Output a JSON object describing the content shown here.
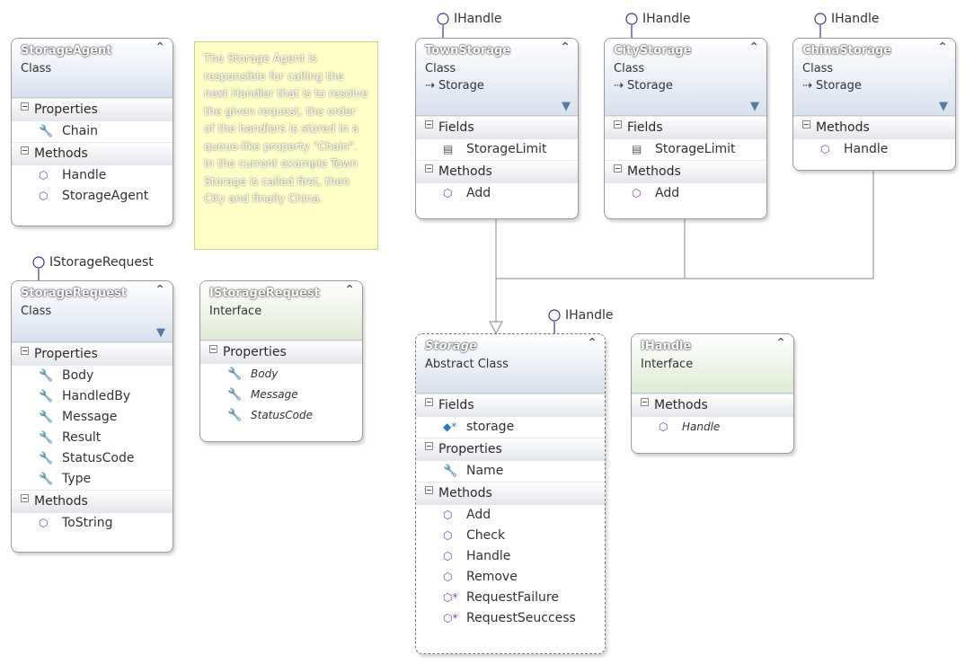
{
  "note": {
    "text": "The Storage Agent is responsible for calling the next Handler that is to resolve the given request, the order of the handlers is stored in a queue-like property \"Chain\". In the current example Town Storage is called first, then City and finally China."
  },
  "lollipops": {
    "town": "IHandle",
    "city": "IHandle",
    "china": "IHandle",
    "storage_request": "IStorageRequest",
    "storage": "IHandle"
  },
  "boxes": {
    "storage_agent": {
      "title": "StorageAgent",
      "stereotype": "Class",
      "sections": [
        {
          "label": "Properties",
          "items": [
            {
              "icon": "wrench-property-icon",
              "name": "Chain"
            }
          ]
        },
        {
          "label": "Methods",
          "items": [
            {
              "icon": "method-cube-icon",
              "name": "Handle"
            },
            {
              "icon": "method-cube-icon",
              "name": "StorageAgent"
            }
          ]
        }
      ]
    },
    "town_storage": {
      "title": "TownStorage",
      "stereotype": "Class",
      "base": "Storage",
      "sections": [
        {
          "label": "Fields",
          "items": [
            {
              "icon": "field-icon",
              "name": "StorageLimit"
            }
          ]
        },
        {
          "label": "Methods",
          "items": [
            {
              "icon": "method-cube-icon",
              "name": "Add"
            }
          ]
        }
      ]
    },
    "city_storage": {
      "title": "CityStorage",
      "stereotype": "Class",
      "base": "Storage",
      "sections": [
        {
          "label": "Fields",
          "items": [
            {
              "icon": "field-icon",
              "name": "StorageLimit"
            }
          ]
        },
        {
          "label": "Methods",
          "items": [
            {
              "icon": "method-cube-icon",
              "name": "Add"
            }
          ]
        }
      ]
    },
    "china_storage": {
      "title": "ChinaStorage",
      "stereotype": "Class",
      "base": "Storage",
      "sections": [
        {
          "label": "Methods",
          "items": [
            {
              "icon": "method-cube-icon",
              "name": "Handle"
            }
          ]
        }
      ]
    },
    "storage_request": {
      "title": "StorageRequest",
      "stereotype": "Class",
      "sections": [
        {
          "label": "Properties",
          "items": [
            {
              "icon": "wrench-property-icon",
              "name": "Body"
            },
            {
              "icon": "wrench-property-icon",
              "name": "HandledBy"
            },
            {
              "icon": "wrench-property-icon",
              "name": "Message"
            },
            {
              "icon": "wrench-property-icon",
              "name": "Result"
            },
            {
              "icon": "wrench-property-icon",
              "name": "StatusCode"
            },
            {
              "icon": "wrench-property-icon",
              "name": "Type"
            }
          ]
        },
        {
          "label": "Methods",
          "items": [
            {
              "icon": "method-cube-icon",
              "name": "ToString"
            }
          ]
        }
      ]
    },
    "istorage_request": {
      "title": "IStorageRequest",
      "stereotype": "Interface",
      "sections": [
        {
          "label": "Properties",
          "items": [
            {
              "icon": "wrench-property-icon",
              "name": "Body"
            },
            {
              "icon": "wrench-property-icon",
              "name": "Message"
            },
            {
              "icon": "wrench-property-icon",
              "name": "StatusCode"
            }
          ]
        }
      ]
    },
    "storage": {
      "title": "Storage",
      "stereotype": "Abstract Class",
      "sections": [
        {
          "label": "Fields",
          "items": [
            {
              "icon": "protected-field-icon",
              "name": "storage"
            }
          ]
        },
        {
          "label": "Properties",
          "items": [
            {
              "icon": "wrench-property-icon",
              "name": "Name"
            }
          ]
        },
        {
          "label": "Methods",
          "items": [
            {
              "icon": "method-cube-icon",
              "name": "Add"
            },
            {
              "icon": "method-cube-icon",
              "name": "Check"
            },
            {
              "icon": "method-cube-icon",
              "name": "Handle"
            },
            {
              "icon": "method-cube-icon",
              "name": "Remove"
            },
            {
              "icon": "protected-method-icon",
              "name": "RequestFailure"
            },
            {
              "icon": "protected-method-icon",
              "name": "RequestSeuccess"
            }
          ]
        }
      ]
    },
    "ihandle": {
      "title": "IHandle",
      "stereotype": "Interface",
      "sections": [
        {
          "label": "Methods",
          "items": [
            {
              "icon": "method-cube-icon",
              "name": "Handle"
            }
          ]
        }
      ]
    }
  }
}
